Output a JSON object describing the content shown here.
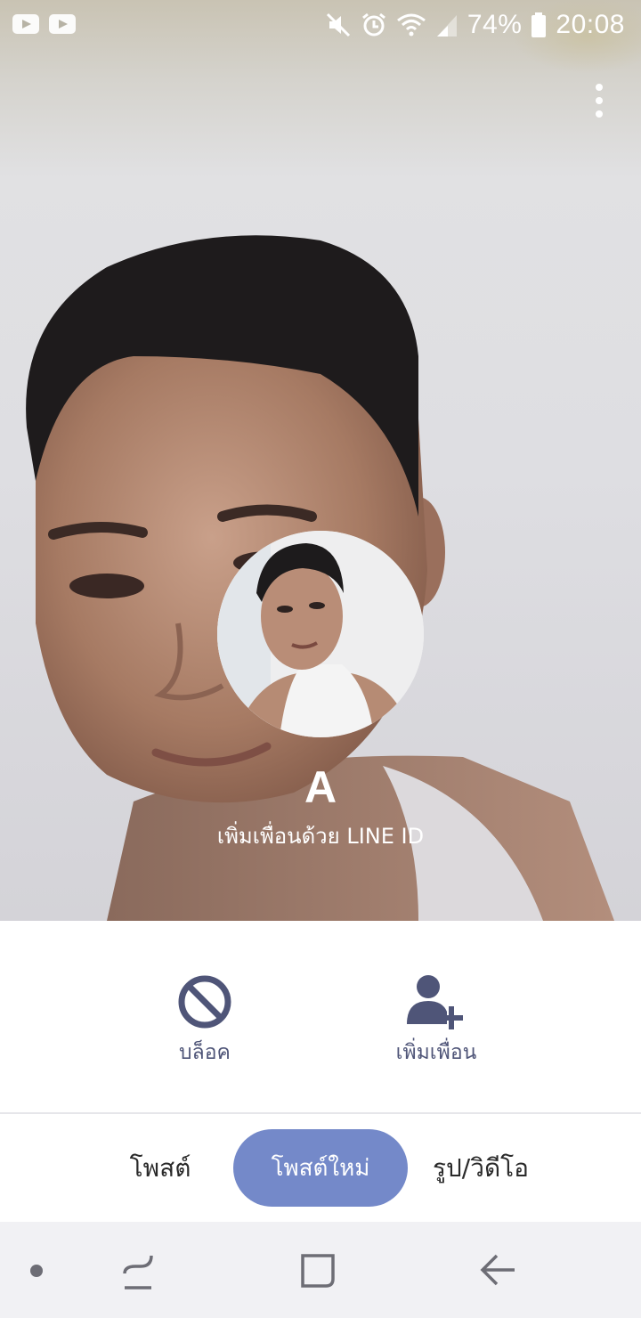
{
  "status_bar": {
    "battery": "74%",
    "time": "20:08",
    "icons": [
      "youtube-icon",
      "youtube-icon",
      "mute-icon",
      "alarm-icon",
      "wifi-icon",
      "signal-icon",
      "battery-icon"
    ]
  },
  "profile": {
    "name": "A",
    "subtitle": "เพิ่มเพื่อนด้วย LINE ID"
  },
  "actions": [
    {
      "label": "บล็อค",
      "icon": "block-icon"
    },
    {
      "label": "เพิ่มเพื่อน",
      "icon": "add-friend-icon"
    }
  ],
  "tabs": [
    {
      "label": "โพสต์",
      "active": false
    },
    {
      "label": "โพสต์ใหม่",
      "active": true
    },
    {
      "label": "รูป/วิดีโอ",
      "active": false
    }
  ],
  "colors": {
    "accent": "#7489c9",
    "icon": "#4f5578",
    "nav_bar": "#f1f1f4"
  },
  "nav": [
    "home-dot-icon",
    "recents-icon",
    "home-icon",
    "back-icon"
  ]
}
